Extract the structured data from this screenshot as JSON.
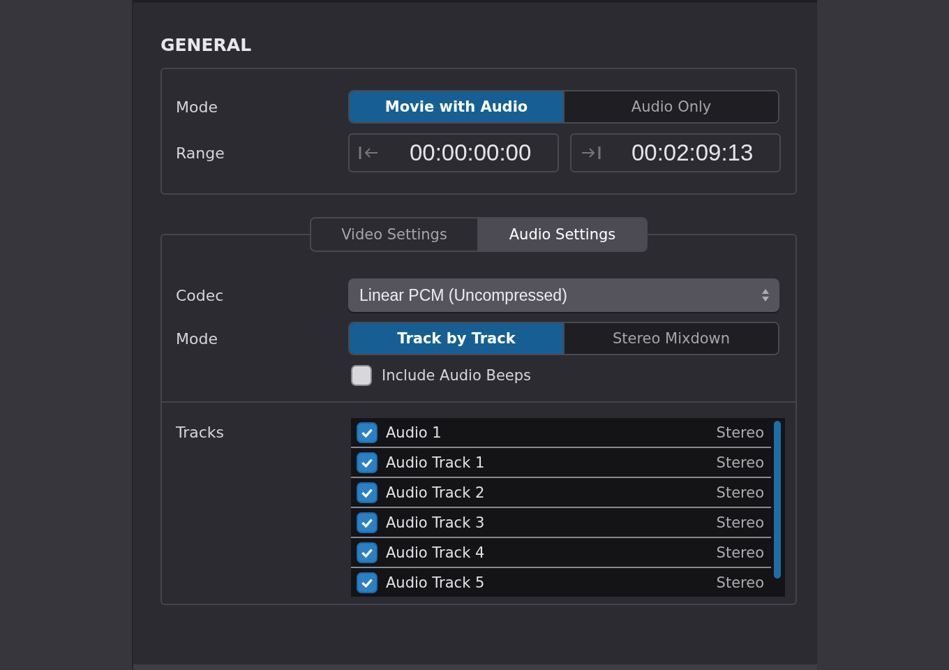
{
  "general": {
    "title": "GENERAL",
    "mode": {
      "label": "Mode",
      "options": [
        {
          "label": "Movie with Audio",
          "selected": true
        },
        {
          "label": "Audio Only",
          "selected": false
        }
      ]
    },
    "range": {
      "label": "Range",
      "start": "00:00:00:00",
      "end": "00:02:09:13"
    }
  },
  "tabs": [
    {
      "label": "Video Settings",
      "selected": false
    },
    {
      "label": "Audio Settings",
      "selected": true
    }
  ],
  "audio": {
    "codec": {
      "label": "Codec",
      "value": "Linear PCM (Uncompressed)"
    },
    "mode": {
      "label": "Mode",
      "options": [
        {
          "label": "Track by Track",
          "selected": true
        },
        {
          "label": "Stereo Mixdown",
          "selected": false
        }
      ]
    },
    "beeps": {
      "label": "Include Audio Beeps",
      "checked": false
    },
    "tracks": {
      "label": "Tracks",
      "items": [
        {
          "name": "Audio 1",
          "format": "Stereo",
          "checked": true
        },
        {
          "name": "Audio Track 1",
          "format": "Stereo",
          "checked": true
        },
        {
          "name": "Audio Track 2",
          "format": "Stereo",
          "checked": true
        },
        {
          "name": "Audio Track 3",
          "format": "Stereo",
          "checked": true
        },
        {
          "name": "Audio Track 4",
          "format": "Stereo",
          "checked": true
        },
        {
          "name": "Audio Track 5",
          "format": "Stereo",
          "checked": true
        }
      ]
    }
  }
}
